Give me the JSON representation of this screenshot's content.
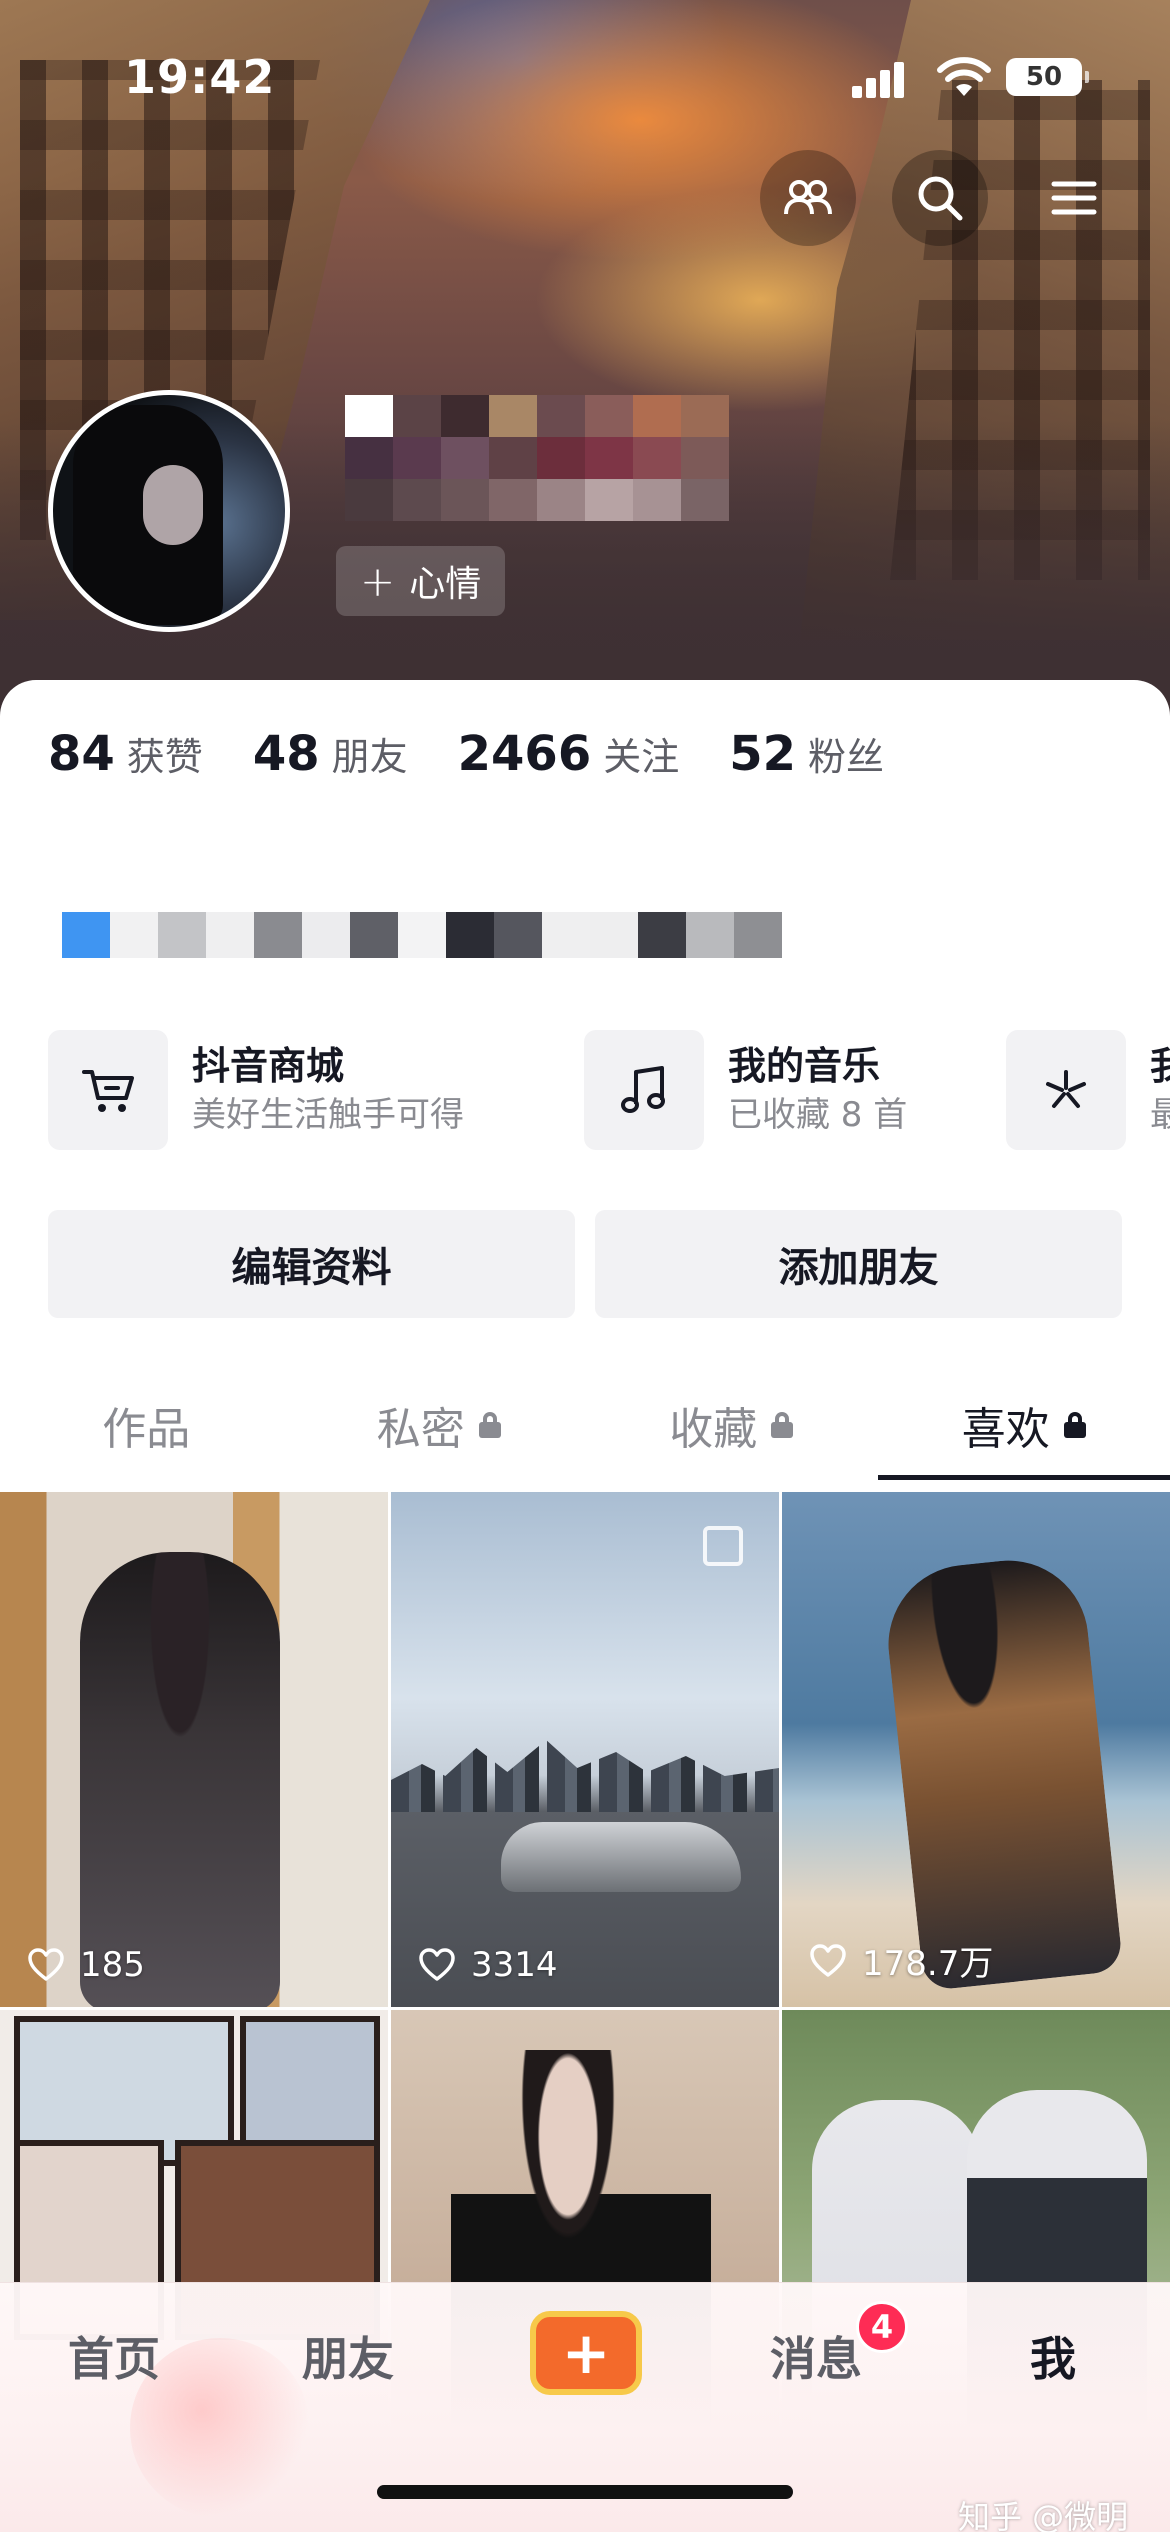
{
  "status_bar": {
    "time": "19:42",
    "battery": "50"
  },
  "profile": {
    "mood_button": "心情",
    "mood_plus": "+"
  },
  "stats": [
    {
      "value": "84",
      "label": "获赞"
    },
    {
      "value": "48",
      "label": "朋友"
    },
    {
      "value": "2466",
      "label": "关注"
    },
    {
      "value": "52",
      "label": "粉丝"
    }
  ],
  "shortcuts": [
    {
      "title": "抖音商城",
      "subtitle": "美好生活触手可得",
      "icon": "cart-icon"
    },
    {
      "title": "我的音乐",
      "subtitle": "已收藏 8 首",
      "icon": "music-note-icon"
    },
    {
      "title": "我",
      "subtitle": "最",
      "icon": "sparkle-icon"
    }
  ],
  "actions": {
    "edit_profile": "编辑资料",
    "add_friends": "添加朋友"
  },
  "tabs": [
    {
      "label": "作品",
      "locked": false,
      "active": false
    },
    {
      "label": "私密",
      "locked": true,
      "active": false
    },
    {
      "label": "收藏",
      "locked": true,
      "active": false
    },
    {
      "label": "喜欢",
      "locked": true,
      "active": true
    }
  ],
  "grid": [
    {
      "likes": "185"
    },
    {
      "likes": "3314"
    },
    {
      "likes": "178.7万"
    },
    {
      "likes": ""
    },
    {
      "likes": ""
    },
    {
      "likes": ""
    }
  ],
  "bottom_nav": {
    "home": "首页",
    "friends": "朋友",
    "plus": "+",
    "messages": "消息",
    "messages_badge": "4",
    "me": "我"
  },
  "watermark": "知乎 @微明",
  "colors": {
    "accent_red": "#fe2c55",
    "plus_orange": "#f36a2b",
    "plus_border": "#f7c94a"
  }
}
